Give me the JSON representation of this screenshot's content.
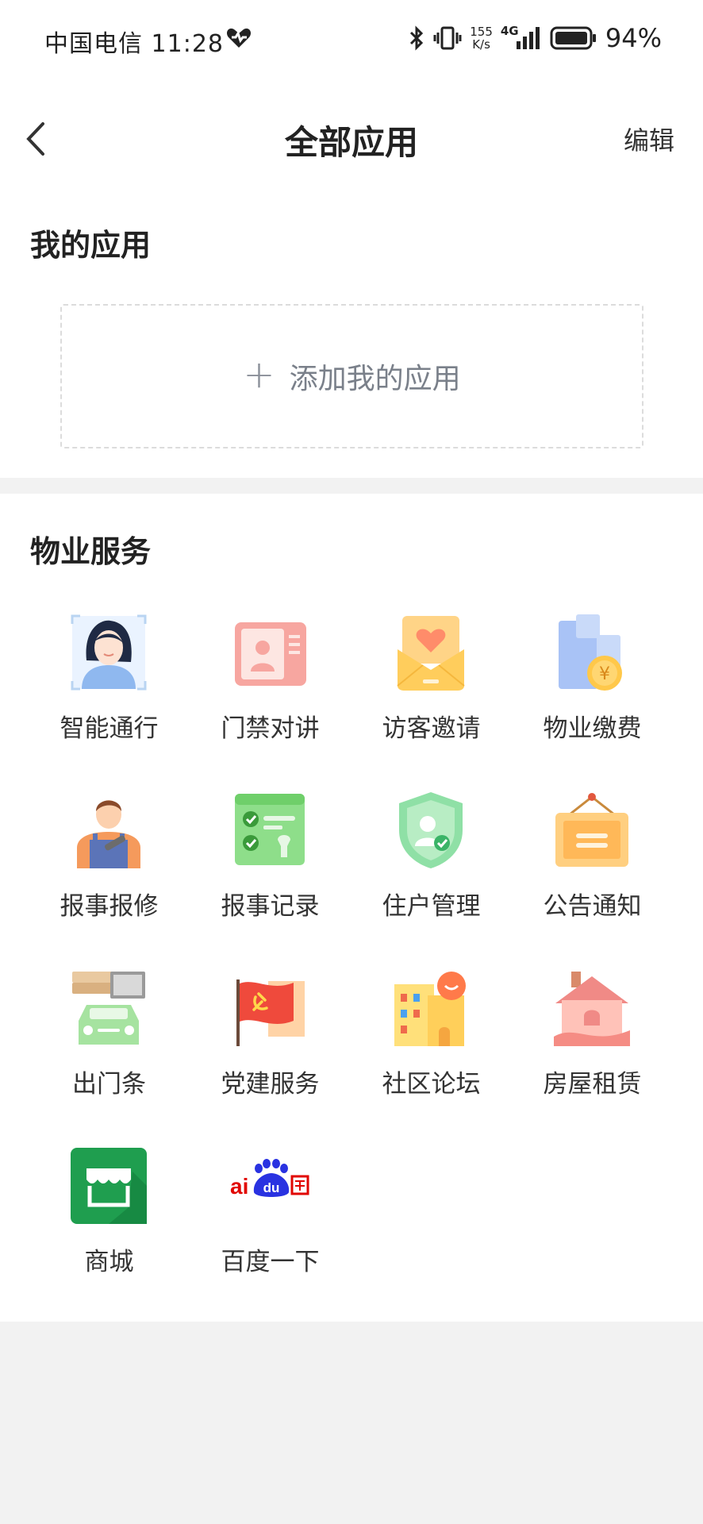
{
  "status": {
    "carrier": "中国电信",
    "time": "11:28",
    "net_speed_top": "155",
    "net_speed_bottom": "K/s",
    "network": "4G",
    "battery": "94%"
  },
  "header": {
    "title": "全部应用",
    "edit_label": "编辑"
  },
  "my_apps": {
    "title": "我的应用",
    "add_label": "添加我的应用"
  },
  "services": {
    "title": "物业服务",
    "items": [
      {
        "label": "智能通行",
        "icon": "face-access-icon"
      },
      {
        "label": "门禁对讲",
        "icon": "intercom-icon"
      },
      {
        "label": "访客邀请",
        "icon": "visitor-invite-icon"
      },
      {
        "label": "物业缴费",
        "icon": "property-fee-icon"
      },
      {
        "label": "报事报修",
        "icon": "repair-worker-icon"
      },
      {
        "label": "报事记录",
        "icon": "report-record-icon"
      },
      {
        "label": "住户管理",
        "icon": "resident-shield-icon"
      },
      {
        "label": "公告通知",
        "icon": "notice-board-icon"
      },
      {
        "label": "出门条",
        "icon": "exit-pass-car-icon"
      },
      {
        "label": "党建服务",
        "icon": "party-flag-icon"
      },
      {
        "label": "社区论坛",
        "icon": "community-forum-icon"
      },
      {
        "label": "房屋租赁",
        "icon": "house-rental-icon"
      },
      {
        "label": "商城",
        "icon": "mall-store-icon"
      },
      {
        "label": "百度一下",
        "icon": "baidu-logo-icon"
      }
    ]
  },
  "colors": {
    "page_bg": "#f2f2f2",
    "card_bg": "#ffffff",
    "mall_green": "#1f9e4f",
    "baidu_blue": "#2932e1",
    "baidu_red": "#e10601"
  }
}
